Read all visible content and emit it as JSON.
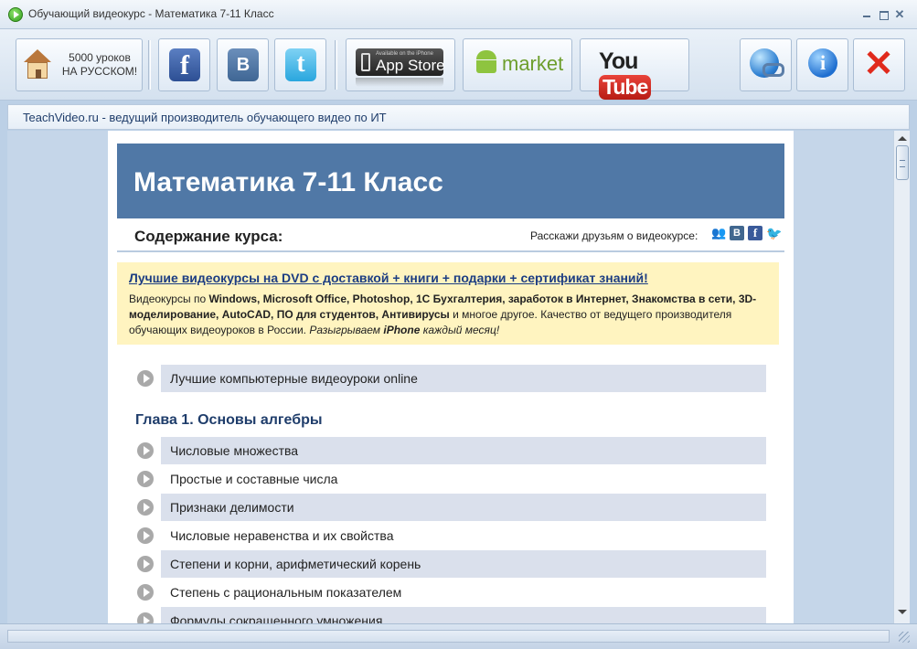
{
  "window": {
    "title": "Обучающий видеокурс - Математика 7-11 Класс",
    "close_glyph": "✕"
  },
  "toolbar": {
    "home_label_line1": "5000 уроков",
    "home_label_line2": "НА РУССКОМ!",
    "facebook_glyph": "f",
    "vk_glyph": "B",
    "twitter_glyph": "t",
    "appstore_small": "Available on the iPhone",
    "appstore_big": "App Store",
    "market_label": "market",
    "youtube_you": "You",
    "youtube_tube": "Tube",
    "info_glyph": "i",
    "exit_glyph": "✕"
  },
  "infobar": {
    "text": "TeachVideo.ru - ведущий производитель обучающего видео по ИТ"
  },
  "page": {
    "banner_title": "Математика 7-11 Класс",
    "contents_title": "Содержание курса:",
    "share_text": "Расскажи друзьям о видеокурсе:",
    "share_icons": {
      "people": "👥",
      "vk": "B",
      "fb": "f",
      "tw": "🐦"
    },
    "promo": {
      "link": "Лучшие видеокурсы на DVD с доставкой + книги + подарки + сертификат знаний!",
      "desc_1": "Видеокурсы по ",
      "desc_b1": "Windows, Microsoft Office, Photoshop, 1С Бухгалтерия, заработок в Интернет, Знакомства в сети, 3D-моделирование, AutoCAD, ПО для студентов, Антивирусы",
      "desc_2": " и многое другое. Качество от ведущего производителя обучающих видеоуроков в России. ",
      "desc_i1": "Разыгрываем ",
      "desc_bi": "iPhone",
      "desc_i2": " каждый месяц!"
    },
    "intro_lesson": "Лучшие компьютерные видеоуроки online",
    "chapter_title": "Глава 1. Основы алгебры",
    "lessons": [
      "Числовые множества",
      "Простые и составные числа",
      "Признаки делимости",
      "Числовые неравенства и их свойства",
      "Степени и корни, арифметический корень",
      "Степень с рациональным показателем",
      "Формулы сокращенного умножения"
    ]
  },
  "colors": {
    "banner": "#5078a6",
    "promo_bg": "#fff4c0",
    "row_alt": "#dae0ec",
    "chapter": "#1f3d6b"
  }
}
